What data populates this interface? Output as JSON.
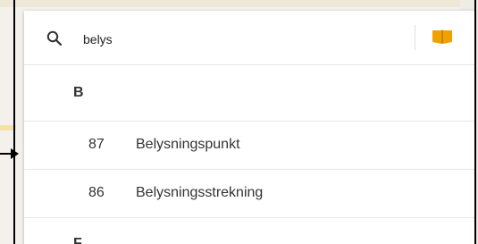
{
  "search": {
    "value": "belys",
    "icon": "search-icon",
    "catalog_icon": "book-icon",
    "accent_color": "#f0a000"
  },
  "groups": [
    {
      "letter": "B",
      "items": [
        {
          "code": "87",
          "label": "Belysningspunkt"
        },
        {
          "code": "86",
          "label": "Belysningsstrekning"
        }
      ]
    },
    {
      "letter": "F"
    }
  ],
  "pointer": {
    "icon": "arrow-right-icon"
  }
}
